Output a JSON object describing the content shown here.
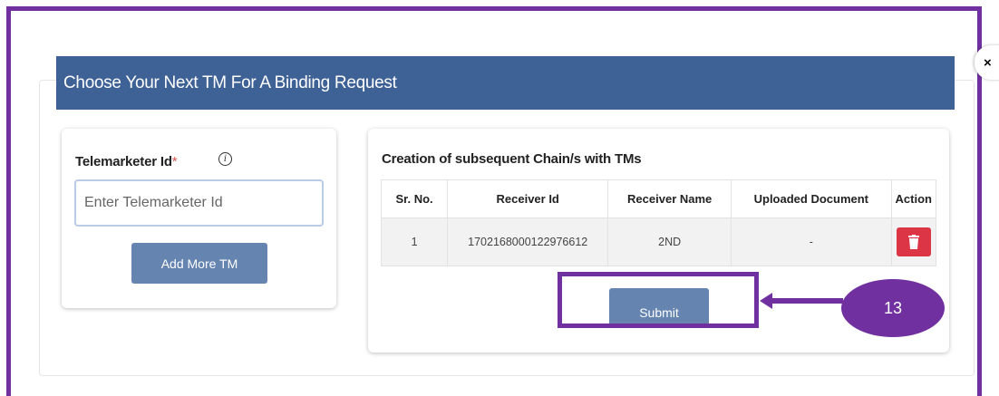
{
  "modal": {
    "title": "Choose Your Next TM For A Binding Request",
    "close_label": "×"
  },
  "telemarketer": {
    "label": "Telemarketer Id",
    "required_mark": "*",
    "info_icon": "info-icon",
    "input_value": "",
    "placeholder": "Enter Telemarketer Id",
    "add_button_label": "Add More TM"
  },
  "chain": {
    "title": "Creation of subsequent Chain/s with TMs",
    "columns": [
      "Sr. No.",
      "Receiver Id",
      "Receiver Name",
      "Uploaded Document",
      "Action"
    ],
    "rows": [
      {
        "sr_no": "1",
        "receiver_id": "1702168000122976612",
        "receiver_name": "2ND",
        "uploaded_document": "-",
        "action_icon": "trash-icon"
      }
    ],
    "submit_label": "Submit"
  },
  "annotation": {
    "step_number": "13",
    "color": "#7030a0"
  },
  "colors": {
    "header": "#3e6196",
    "button": "#6684b0",
    "delete": "#dc3545",
    "required": "#d9534f"
  }
}
